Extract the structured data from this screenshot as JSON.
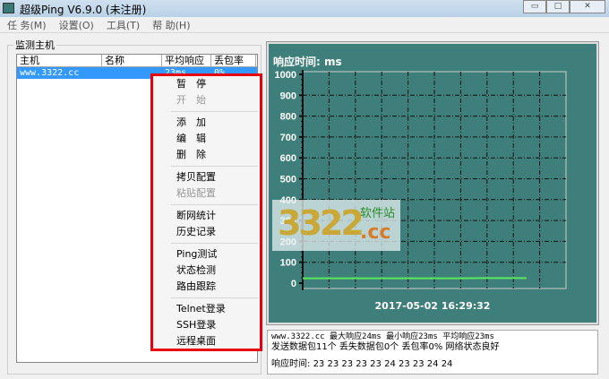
{
  "window": {
    "title": "超级Ping V6.9.0 (未注册)",
    "minimize": "▭",
    "maximize": "□",
    "close": "✕"
  },
  "menu": [
    "任 务(M)",
    "设置(O)",
    "工具(T)",
    "帮 助(H)"
  ],
  "group_label": "监测主机",
  "list": {
    "columns": [
      "主机",
      "名称",
      "平均响应",
      "丢包率"
    ],
    "rows": [
      {
        "host": "www.3322.cc",
        "name": "",
        "avg": "23ms",
        "loss": "0%"
      }
    ]
  },
  "context_menu": [
    [
      {
        "label": "暂　停",
        "enabled": true
      },
      {
        "label": "开　始",
        "enabled": false
      }
    ],
    [
      {
        "label": "添　加",
        "enabled": true
      },
      {
        "label": "编　辑",
        "enabled": true
      },
      {
        "label": "删　除",
        "enabled": true
      }
    ],
    [
      {
        "label": "拷贝配置",
        "enabled": true
      },
      {
        "label": "粘贴配置",
        "enabled": false
      }
    ],
    [
      {
        "label": "断网统计",
        "enabled": true
      },
      {
        "label": "历史记录",
        "enabled": true
      }
    ],
    [
      {
        "label": "Ping测试",
        "enabled": true
      },
      {
        "label": "状态检测",
        "enabled": true
      },
      {
        "label": "路由跟踪",
        "enabled": true
      }
    ],
    [
      {
        "label": "Telnet登录",
        "enabled": true
      },
      {
        "label": "SSH登录",
        "enabled": true
      },
      {
        "label": "远程桌面",
        "enabled": true
      }
    ]
  ],
  "chart_data": {
    "type": "line",
    "title": "响应时间: ms",
    "ylim": [
      0,
      1000
    ],
    "yticks": [
      0,
      100,
      200,
      300,
      400,
      500,
      600,
      700,
      800,
      900,
      1000
    ],
    "xlabel": "2017-05-02   16:29:32",
    "grid": true,
    "series": [
      {
        "name": "www.3322.cc",
        "color": "#5ee85e",
        "values": [
          23,
          23,
          23,
          23,
          23,
          23,
          23,
          23,
          24,
          24,
          24
        ]
      }
    ],
    "x_divisions": 10
  },
  "info": {
    "line1": "www.3322.cc 最大响应24ms 最小响应23ms 平均响应23ms",
    "line2": "发送数据包11个 丢失数据包0个 丢包率0%  网络状态良好",
    "line3_label": "响应时间:",
    "line3_values": "23 23 23 23 23 24 23 23 24 24"
  },
  "watermark": {
    "number": "3322",
    "site": "软件站",
    "tld": ".cc"
  }
}
